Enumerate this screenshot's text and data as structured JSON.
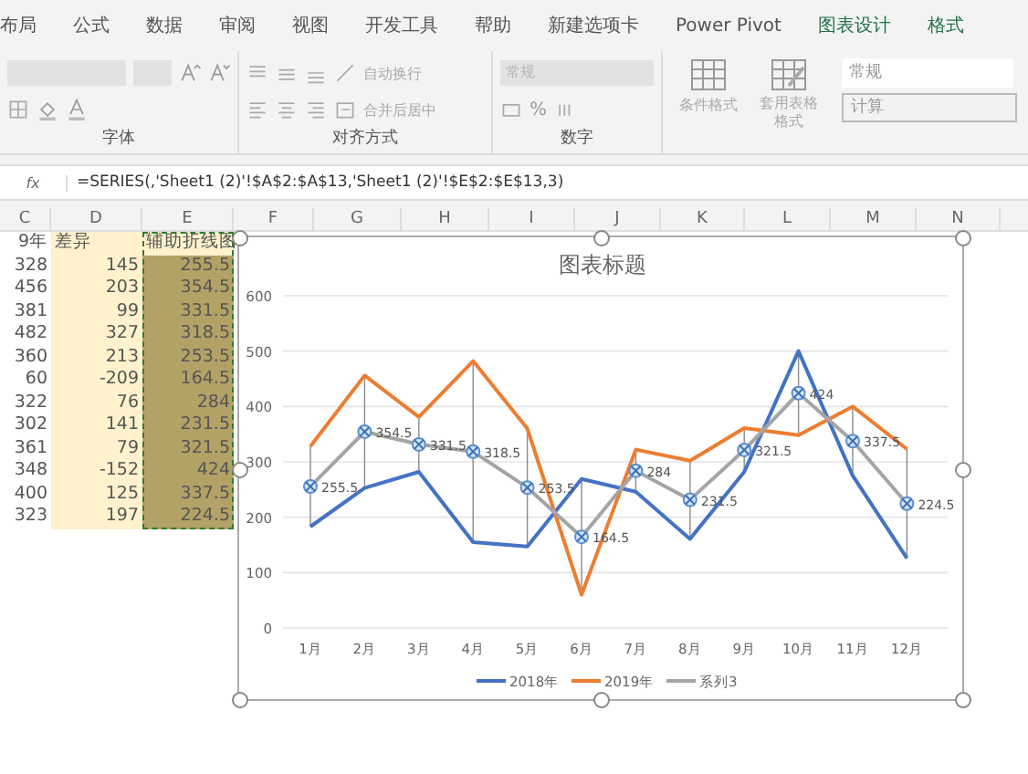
{
  "ribbon_tabs": [
    {
      "label": "布局",
      "kind": "normal"
    },
    {
      "label": "公式",
      "kind": "normal"
    },
    {
      "label": "数据",
      "kind": "normal"
    },
    {
      "label": "审阅",
      "kind": "normal"
    },
    {
      "label": "视图",
      "kind": "normal"
    },
    {
      "label": "开发工具",
      "kind": "normal"
    },
    {
      "label": "帮助",
      "kind": "normal"
    },
    {
      "label": "新建选项卡",
      "kind": "normal"
    },
    {
      "label": "Power Pivot",
      "kind": "normal"
    },
    {
      "label": "图表设计",
      "kind": "contextual"
    },
    {
      "label": "格式",
      "kind": "contextual"
    }
  ],
  "ribbon": {
    "font_group": "字体",
    "align_group": "对齐方式",
    "wrap_text": "自动换行",
    "merge_center": "合并后居中",
    "number_group": "数字",
    "number_format": "常规",
    "percent": "%",
    "conditional_format": "条件格式",
    "table_format": "套用表格格式",
    "styles": [
      "常规",
      "计算"
    ]
  },
  "formula_bar": {
    "fx": "fx",
    "formula": "=SERIES(,'Sheet1 (2)'!$A$2:$A$13,'Sheet1 (2)'!$E$2:$E$13,3)"
  },
  "columns": [
    "C",
    "D",
    "E",
    "F",
    "G",
    "H",
    "I",
    "J",
    "K",
    "L",
    "M",
    "N"
  ],
  "sheet": {
    "header": [
      "9年",
      "差异",
      "辅助折线图"
    ],
    "rows": [
      [
        "328",
        "145",
        "255.5"
      ],
      [
        "456",
        "203",
        "354.5"
      ],
      [
        "381",
        "99",
        "331.5"
      ],
      [
        "482",
        "327",
        "318.5"
      ],
      [
        "360",
        "213",
        "253.5"
      ],
      [
        "60",
        "-209",
        "164.5"
      ],
      [
        "322",
        "76",
        "284"
      ],
      [
        "302",
        "141",
        "231.5"
      ],
      [
        "361",
        "79",
        "321.5"
      ],
      [
        "348",
        "-152",
        "424"
      ],
      [
        "400",
        "125",
        "337.5"
      ],
      [
        "323",
        "197",
        "224.5"
      ]
    ]
  },
  "chart": {
    "chart_data": {
      "type": "line",
      "title": "图表标题",
      "grid": true,
      "legend": true,
      "categories": [
        "1月",
        "2月",
        "3月",
        "4月",
        "5月",
        "6月",
        "7月",
        "8月",
        "9月",
        "10月",
        "11月",
        "12月"
      ],
      "ylim": [
        0,
        600
      ],
      "yticks": [
        0,
        100,
        200,
        300,
        400,
        500,
        600
      ],
      "series": [
        {
          "name": "2018年",
          "color": "#4472c4",
          "values": [
            183,
            253,
            282,
            155,
            147,
            269,
            246,
            161,
            282,
            500,
            275,
            126
          ]
        },
        {
          "name": "2019年",
          "color": "#ed7d31",
          "values": [
            328,
            456,
            381,
            482,
            360,
            60,
            322,
            302,
            361,
            348,
            400,
            323
          ]
        },
        {
          "name": "系列3",
          "color": "#a5a5a5",
          "values": [
            255.5,
            354.5,
            331.5,
            318.5,
            253.5,
            164.5,
            284,
            231.5,
            321.5,
            424,
            337.5,
            224.5
          ],
          "value_labels": [
            "255.5",
            "354.5",
            "331.5",
            "318.5",
            "253.5",
            "164.5",
            "284",
            "231.5",
            "321.5",
            "424",
            "337.5",
            "224.5"
          ],
          "marker": "circle-x",
          "errors": [
            72.5,
            101.5,
            49.5,
            163.5,
            106.5,
            104.5,
            38,
            70.5,
            39.5,
            76,
            62.5,
            98.5
          ]
        }
      ]
    }
  }
}
